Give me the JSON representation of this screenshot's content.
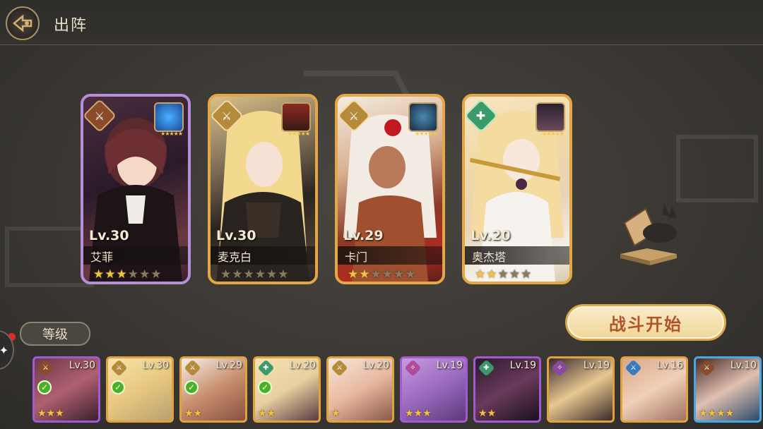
{
  "header": {
    "title": "出阵"
  },
  "team": [
    {
      "level": "Lv.30",
      "name": "艾菲",
      "frame": "purple",
      "type": "attack",
      "stars": 3,
      "max_stars": 6
    },
    {
      "level": "Lv.30",
      "name": "麦克白",
      "frame": "gold",
      "type": "attack",
      "stars": 0,
      "max_stars": 6
    },
    {
      "level": "Lv.29",
      "name": "卡门",
      "frame": "gold",
      "type": "attack",
      "stars": 2,
      "max_stars": 6
    },
    {
      "level": "Lv.20",
      "name": "奥杰塔",
      "frame": "gold",
      "type": "support",
      "stars": 2,
      "max_stars": 5
    }
  ],
  "start_button": {
    "label": "战斗开始"
  },
  "sort_button": {
    "label": "等级"
  },
  "roster": [
    {
      "level": "Lv.30",
      "frame": "purple",
      "type": "attack",
      "selected": true,
      "stars": "★★★"
    },
    {
      "level": "Lv.30",
      "frame": "gold",
      "type": "attack-gold",
      "selected": true,
      "stars": ""
    },
    {
      "level": "Lv.29",
      "frame": "gold",
      "type": "attack-gold",
      "selected": true,
      "stars": "★★"
    },
    {
      "level": "Lv.20",
      "frame": "gold",
      "type": "support",
      "selected": true,
      "stars": "★★"
    },
    {
      "level": "Lv.20",
      "frame": "gold",
      "type": "attack-gold",
      "selected": false,
      "stars": "★"
    },
    {
      "level": "Lv.19",
      "frame": "purple",
      "type": "magic",
      "selected": false,
      "stars": "★★★"
    },
    {
      "level": "Lv.19",
      "frame": "purple",
      "type": "heal",
      "selected": false,
      "stars": "★★"
    },
    {
      "level": "Lv.19",
      "frame": "gold",
      "type": "magic",
      "selected": false,
      "stars": ""
    },
    {
      "level": "Lv.16",
      "frame": "gold",
      "type": "blue",
      "selected": false,
      "stars": ""
    },
    {
      "level": "Lv.10",
      "frame": "blue",
      "type": "attack",
      "selected": false,
      "stars": "★★★★"
    }
  ],
  "colors": {
    "gold_frame": "#e4a748",
    "purple_frame": "#b68fd8",
    "start_text": "#b2542a"
  }
}
